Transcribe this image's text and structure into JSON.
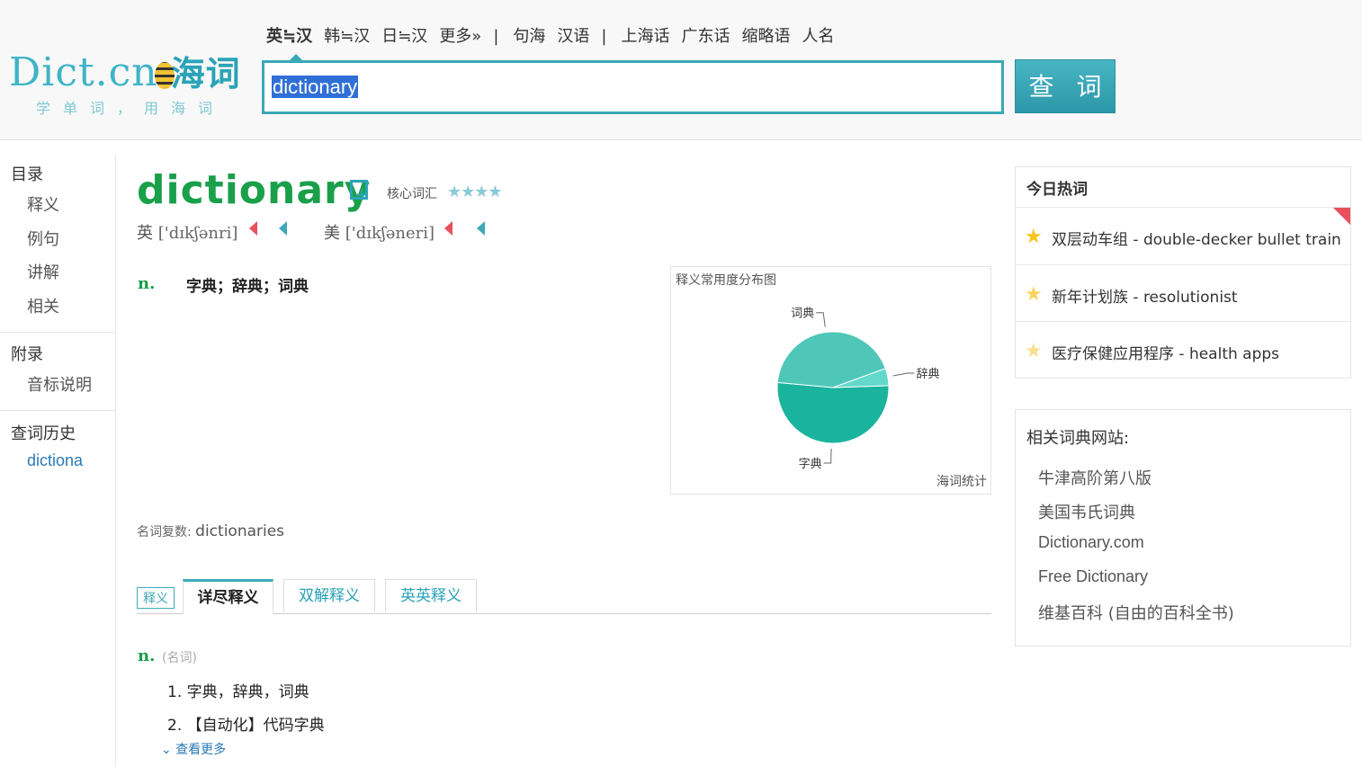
{
  "header": {
    "logo_text": "Dict.cn",
    "logo_cn": "海词",
    "slogan": "学单词，用海词",
    "lang_nav": [
      "英≒汉",
      "韩≒汉",
      "日≒汉",
      "更多»",
      "|",
      "句海",
      "汉语",
      "|",
      "上海话",
      "广东话",
      "缩略语",
      "人名"
    ],
    "search_value": "dictionary",
    "search_button": "查 词"
  },
  "leftnav": {
    "toc_title": "目录",
    "toc_items": [
      "释义",
      "例句",
      "讲解",
      "相关"
    ],
    "appendix_title": "附录",
    "appendix_items": [
      "音标说明"
    ],
    "history_title": "查词历史",
    "history_items": [
      "dictiona"
    ]
  },
  "entry": {
    "word": "dictionary",
    "level": "核心词汇",
    "stars": "★★★★",
    "uk_label": "英",
    "uk_ipa": "['dɪkʃənri]",
    "us_label": "美",
    "us_ipa": "['dɪkʃəneri]",
    "pos": "n.",
    "short_def": "字典；辞典；词典",
    "plural_label": "名词复数:",
    "plural_value": "dictionaries"
  },
  "chart_data": {
    "type": "pie",
    "title": "释义常用度分布图",
    "source": "海词统计",
    "labels": [
      "字典",
      "词典",
      "辞典"
    ],
    "values": [
      52,
      43,
      5
    ],
    "colors": [
      "#1ab39e",
      "#4fc7b8",
      "#62d9cb"
    ]
  },
  "tabs": {
    "tag": "释义",
    "items": [
      "详尽释义",
      "双解释义",
      "英英释义"
    ],
    "active": 0
  },
  "detail": {
    "pos": "n.",
    "pos_cn": "(名词)",
    "defs": [
      "1. 字典，辞典，词典",
      "2. 【自动化】代码字典"
    ],
    "more": "查看更多"
  },
  "hotwords": {
    "title": "今日热词",
    "items": [
      "双层动车组 - double-decker bullet train",
      "新年计划族 - resolutionist",
      "医疗保健应用程序 - health apps"
    ]
  },
  "related": {
    "title": "相关词典网站:",
    "items": [
      "牛津高阶第八版",
      "美国韦氏词典",
      "Dictionary.com",
      "Free Dictionary",
      "维基百科 (自由的百科全书)"
    ]
  }
}
